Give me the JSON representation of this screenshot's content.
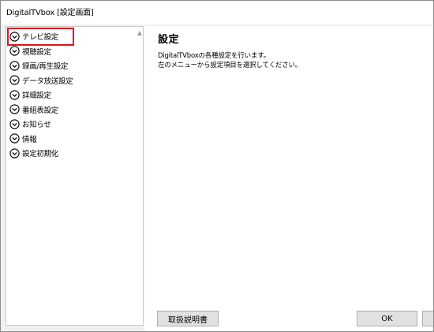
{
  "window": {
    "title": "DigitalTVbox [設定画面]"
  },
  "sidebar": {
    "scroll_up_glyph": "▲",
    "items": [
      {
        "label": "テレビ設定",
        "selected": true
      },
      {
        "label": "視聴設定"
      },
      {
        "label": "録画/再生設定"
      },
      {
        "label": "データ放送設定"
      },
      {
        "label": "詳細設定"
      },
      {
        "label": "番組表設定"
      },
      {
        "label": "お知らせ"
      },
      {
        "label": "情報"
      },
      {
        "label": "設定初期化"
      }
    ],
    "item_icon": "chevron-circle-down-icon",
    "highlight_color": "#e0141c"
  },
  "main": {
    "heading": "設定",
    "description": [
      "DigitalTVboxの各種設定を行います。",
      "左のメニューから設定項目を選択してください。"
    ]
  },
  "buttons": {
    "manual": "取扱説明書",
    "ok": "OK"
  }
}
